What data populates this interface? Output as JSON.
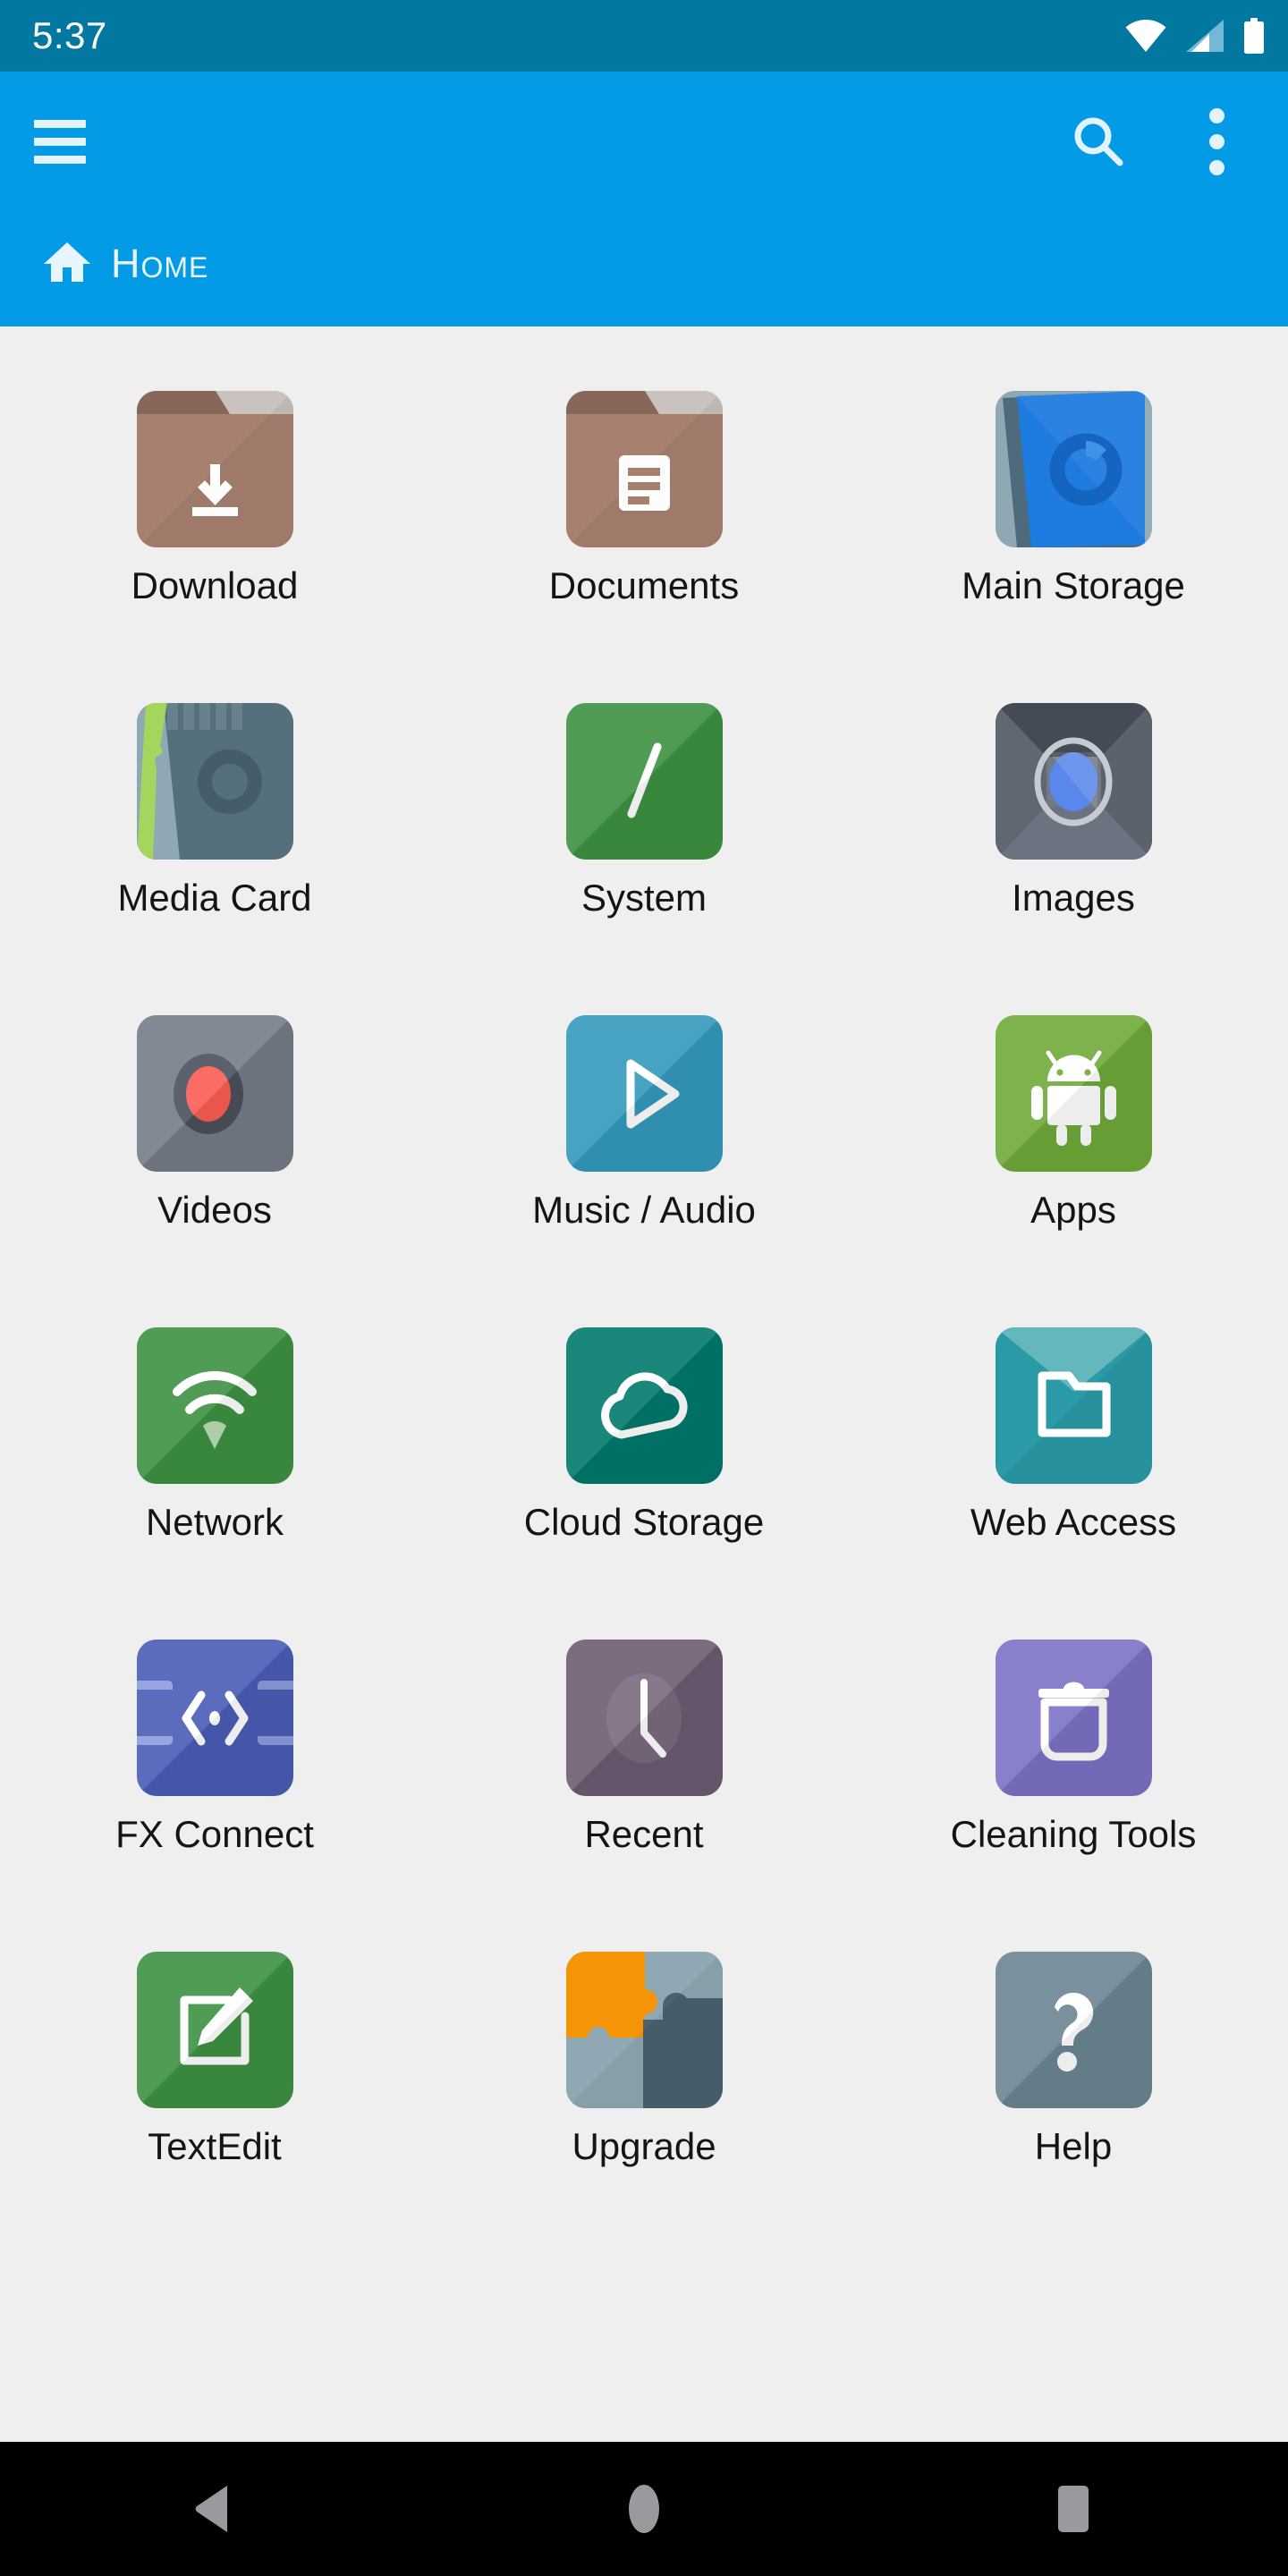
{
  "status_bar": {
    "clock": "5:37",
    "icons": [
      "wifi-icon",
      "cellular-signal-icon",
      "battery-icon"
    ],
    "background": "#0277A0"
  },
  "app_bar": {
    "background": "#039BE5",
    "menu_icon": "hamburger-menu-icon",
    "search_icon": "search-icon",
    "overflow_icon": "overflow-menu-icon"
  },
  "breadcrumb": {
    "home_icon": "home-icon",
    "label": "HOME"
  },
  "content": {
    "background": "#EFEFEF",
    "columns": 3,
    "tiles": [
      {
        "label": "Download",
        "icon": "folder-download-icon",
        "color": "#A8806F"
      },
      {
        "label": "Documents",
        "icon": "folder-documents-icon",
        "color": "#A8806F"
      },
      {
        "label": "Main Storage",
        "icon": "main-storage-icon",
        "color": "#1E7BE0"
      },
      {
        "label": "Media Card",
        "icon": "sd-card-icon",
        "color": "#5A7482"
      },
      {
        "label": "System",
        "icon": "system-slash-icon",
        "color": "#3C9141"
      },
      {
        "label": "Images",
        "icon": "images-lens-icon",
        "color": "#727A86"
      },
      {
        "label": "Videos",
        "icon": "videos-record-icon",
        "color": "#747B88"
      },
      {
        "label": "Music / Audio",
        "icon": "music-play-icon",
        "color": "#3399BC"
      },
      {
        "label": "Apps",
        "icon": "android-apps-icon",
        "color": "#6FA939"
      },
      {
        "label": "Network",
        "icon": "network-wifi-icon",
        "color": "#3C9141"
      },
      {
        "label": "Cloud Storage",
        "icon": "cloud-storage-icon",
        "color": "#00796B"
      },
      {
        "label": "Web Access",
        "icon": "web-access-folder-icon",
        "color": "#2A9AA6"
      },
      {
        "label": "FX Connect",
        "icon": "fx-connect-icon",
        "color": "#4A5BB5"
      },
      {
        "label": "Recent",
        "icon": "recent-clock-icon",
        "color": "#6E5B72"
      },
      {
        "label": "Cleaning Tools",
        "icon": "trash-clean-icon",
        "color": "#7B72C4"
      },
      {
        "label": "TextEdit",
        "icon": "text-edit-icon",
        "color": "#3C9141"
      },
      {
        "label": "Upgrade",
        "icon": "puzzle-upgrade-icon",
        "color": "#F59405"
      },
      {
        "label": "Help",
        "icon": "help-question-icon",
        "color": "#6B8492"
      }
    ]
  },
  "nav_bar": {
    "background": "#000000",
    "back_label": "Back",
    "home_label": "Home",
    "recents_label": "Recents"
  }
}
